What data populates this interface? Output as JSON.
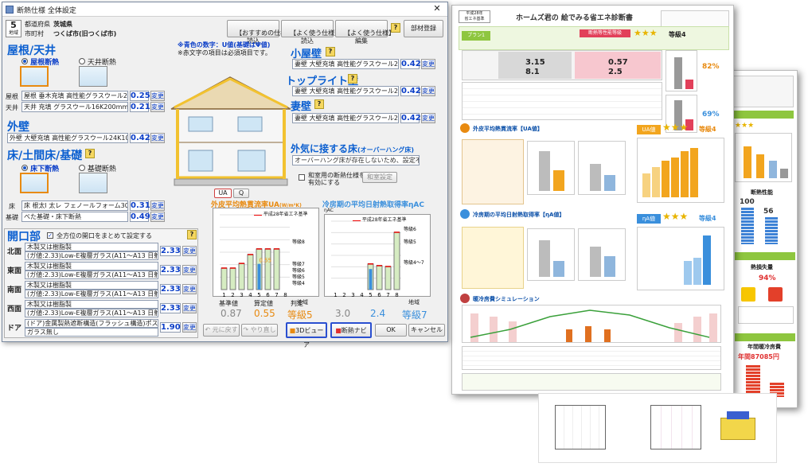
{
  "window": {
    "title": "断熱仕様 全体設定",
    "close_glyph": "✕"
  },
  "region": {
    "number": "5",
    "sub": "地域",
    "pref_label": "都道府県",
    "pref": "茨城県",
    "city_label": "市町村",
    "city": "つくば市(旧つくば市)"
  },
  "toolbar": {
    "recommended": "【おすすめの仕様】\n読込",
    "frequent_load": "【よく使う仕様】\n読込",
    "frequent_edit": "【よく使う仕様】\n編集",
    "help": "?",
    "register": "部材登録"
  },
  "notes": {
    "blue": "※青色の数字：U値(基礎はΨ値)",
    "red": "※赤文字の項目は必須項目です。"
  },
  "roof": {
    "title": "屋根/天井",
    "opt1": "屋根断熱",
    "opt2": "天井断熱",
    "rows": [
      {
        "label": "屋根",
        "spec": "屋根 垂木充填 高性能グラスウール24K200m",
        "value": "0.25",
        "btn": "変更"
      },
      {
        "label": "天井",
        "spec": "天井 充填 グラスウール16K200mm",
        "value": "0.21",
        "btn": "変更"
      }
    ]
  },
  "wall": {
    "title": "外壁",
    "spec": "外壁 大壁充填 高性能グラスウール24K100m",
    "value": "0.42",
    "btn": "変更"
  },
  "floor": {
    "title": "床/土間床/基礎",
    "opt1": "床下断熱",
    "opt2": "基礎断熱",
    "rows": [
      {
        "label": "床",
        "spec": "床 根太l 太レ フェノールフォーム30mm",
        "value": "0.31",
        "btn": "変更"
      },
      {
        "label": "基礎",
        "spec": "べた基礎・床下断熱",
        "value": "0.49",
        "btn": "変更"
      }
    ]
  },
  "opening": {
    "title": "開口部",
    "check_label": "全方位の開口をまとめて設定する",
    "rows": [
      {
        "label": "北面",
        "spec": "木製又は樹脂製",
        "spec2": "(ガ値:2.33)Low-E複層ガラス(A11～A13 日射取得型)",
        "value": "2.33",
        "btn": "変更"
      },
      {
        "label": "東面",
        "spec": "木製又は樹脂製",
        "spec2": "(ガ値:2.33)Low-E複層ガラス(A11～A13 日射取得型)",
        "value": "2.33",
        "btn": "変更"
      },
      {
        "label": "南面",
        "spec": "木製又は樹脂製",
        "spec2": "(ガ値:2.33)Low-E複層ガラス(A11～A13 日射取得型)",
        "value": "2.33",
        "btn": "変更"
      },
      {
        "label": "西面",
        "spec": "木製又は樹脂製",
        "spec2": "(ガ値:2.33)Low-E複層ガラス(A11～A13 日射取得型)",
        "value": "2.33",
        "btn": "変更"
      },
      {
        "label": "ドア",
        "spec": "(ドア)金属製熱遮断構造(フラッシュ構造)ポストなし",
        "spec2": "ガラス無し",
        "value": "1.90",
        "btn": "変更"
      }
    ]
  },
  "attic": {
    "title": "小屋壁",
    "spec": "妻壁 大壁充填 高性能グラスウール24K100",
    "value": "0.42",
    "btn": "変更"
  },
  "toplight": {
    "title": "トップライト壁",
    "spec": "妻壁 大壁充填 高性能グラスウール24K100",
    "value": "0.42",
    "btn": "変更"
  },
  "gable": {
    "title": "妻壁",
    "spec": "妻壁 大壁充填 高性能グラスウール24K100",
    "value": "0.42",
    "btn": "変更"
  },
  "overhang": {
    "title": "外気に接する床",
    "title_sub": "(オーバーハング床)",
    "note": "オーバーハング床が存在しないため、設定不要"
  },
  "wasitsu": {
    "label": "和室用の断熱仕様を\n有効にする",
    "btn": "和室設定"
  },
  "ua_chart_tabs": {
    "tab1": "UA",
    "tab2": "Q"
  },
  "ua_chart": {
    "title": "外皮平均熱貫流率UA",
    "unit": "(W/m²K)",
    "legend": "平成28年省エネ基準",
    "grades": [
      "等級8",
      "等級7",
      "等級6",
      "等級5",
      "等級4"
    ],
    "value_label": "0.55",
    "x_label": "地域",
    "foot_labels": [
      "基準値",
      "算定値",
      "判定"
    ],
    "foot_values": [
      "0.87",
      "0.55",
      "等級5"
    ]
  },
  "eta_chart": {
    "title": "冷房期の平均日射熱取得率ηAC",
    "unit": "ηAC",
    "legend": "平成28年省エネ基準",
    "grades": [
      "等級6",
      "等級5",
      "等級4～7"
    ],
    "x_label": "地域",
    "foot_values": [
      "3.0",
      "2.4",
      "等級7"
    ]
  },
  "chart_data": [
    {
      "type": "bar",
      "title": "外皮平均熱貫流率UA",
      "categories": [
        "1",
        "2",
        "3",
        "4",
        "5",
        "6",
        "7",
        "8"
      ],
      "series": [
        {
          "name": "平成28年省エネ基準",
          "values": [
            0.46,
            0.46,
            0.56,
            0.75,
            0.87,
            0.87,
            0.87,
            null
          ]
        }
      ],
      "xlabel": "地域",
      "ylabel": "",
      "ylim": [
        0,
        1.6
      ]
    },
    {
      "type": "bar",
      "title": "冷房期の平均日射熱取得率ηAC",
      "categories": [
        "1",
        "2",
        "3",
        "4",
        "5",
        "6",
        "7",
        "8"
      ],
      "series": [
        {
          "name": "平成28年省エネ基準",
          "values": [
            null,
            null,
            null,
            null,
            3.0,
            2.8,
            2.7,
            6.7
          ]
        }
      ],
      "xlabel": "地域",
      "ylabel": "",
      "ylim": [
        0,
        8
      ]
    }
  ],
  "bottom_buttons": {
    "undo": "元に戻す",
    "redo": "やり直し",
    "view3d": "3Dビューア",
    "navi": "断熱ナビ",
    "ok": "OK",
    "cancel": "キャンセル"
  },
  "report": {
    "title": "ホームズ君の 絵でみる省エネ診断書",
    "plan_label": "プラン1",
    "eval_label": "断熱等性能等級",
    "grade": "等級4",
    "section_ua": "外皮平均熱貫流率【UA値】",
    "section_eta": "冷房期の平均日射熱取得率【ηA値】",
    "section_sim": "暖冷房費シミュレーション",
    "ua_badge": "UA値",
    "eta_badge": "ηA値",
    "ua_big": "3.15",
    "ua_big2": "0.57",
    "eta_big": "8.1",
    "eta_big2": "2.5",
    "pct": "82%",
    "pct2": "69%",
    "back_title": "断熱性能",
    "back_vals": [
      "100",
      "56"
    ],
    "back_loss": "熱損失量",
    "back_pct": "94%",
    "back_cost": "年間暖冷房費",
    "back_yen": "年間87085円"
  }
}
